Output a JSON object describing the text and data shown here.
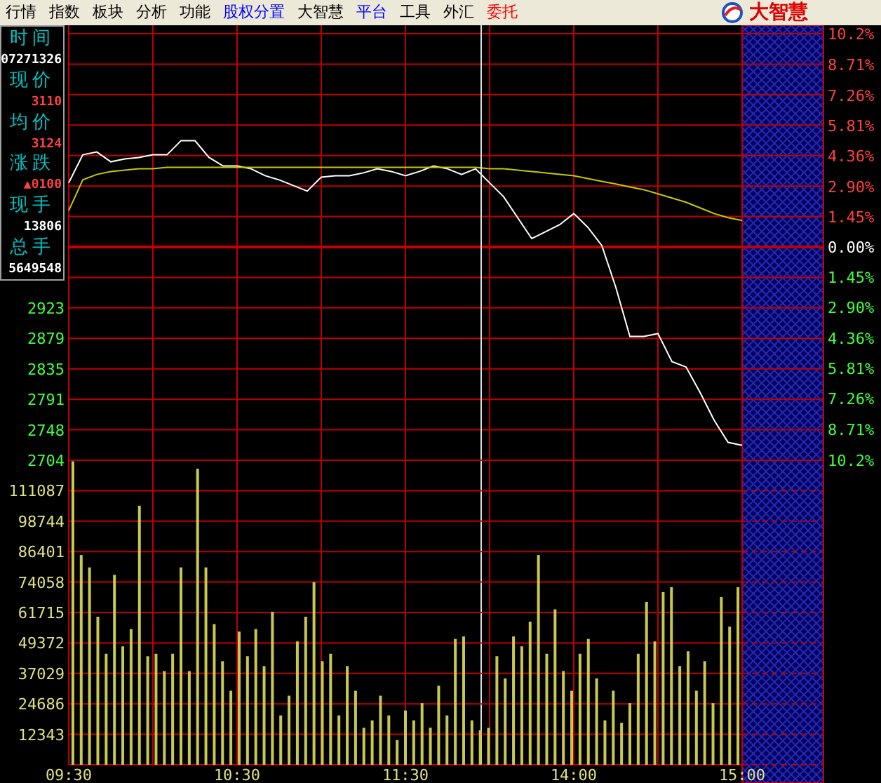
{
  "menu": [
    {
      "label": "行情",
      "color": "#000000"
    },
    {
      "label": "指数",
      "color": "#000000"
    },
    {
      "label": "板块",
      "color": "#000000"
    },
    {
      "label": "分析",
      "color": "#000000"
    },
    {
      "label": "功能",
      "color": "#000000"
    },
    {
      "label": "股权分置",
      "color": "#0000ff"
    },
    {
      "label": "大智慧",
      "color": "#000000"
    },
    {
      "label": "平台",
      "color": "#0000ff"
    },
    {
      "label": "工具",
      "color": "#000000"
    },
    {
      "label": "外汇",
      "color": "#000000"
    },
    {
      "label": "委托",
      "color": "#ff0000"
    }
  ],
  "brand": {
    "name": "大智慧"
  },
  "quote_panel": [
    {
      "label": "时间",
      "value": "07271326",
      "kind": "neutral"
    },
    {
      "label": "现价",
      "value": "3110",
      "kind": "up"
    },
    {
      "label": "均价",
      "value": "3124",
      "kind": "up"
    },
    {
      "label": "涨跌",
      "value": "▲0100",
      "kind": "up"
    },
    {
      "label": "现手",
      "value": "13806",
      "kind": "neutral"
    },
    {
      "label": "总手",
      "value": "5649548",
      "kind": "neutral"
    }
  ],
  "price_chart": {
    "left_axis_labels": [
      "2923",
      "2879",
      "2835",
      "2791",
      "2748",
      "2704"
    ],
    "chart_data": {
      "type": "line",
      "ylim": [
        -10.2,
        10.2
      ],
      "grid": true,
      "yticks": [
        {
          "value": 10.2,
          "label": "10.2%"
        },
        {
          "value": 8.71,
          "label": "8.71%"
        },
        {
          "value": 7.26,
          "label": "7.26%"
        },
        {
          "value": 5.81,
          "label": "5.81%"
        },
        {
          "value": 4.36,
          "label": "4.36%"
        },
        {
          "value": 2.9,
          "label": "2.90%"
        },
        {
          "value": 1.45,
          "label": "1.45%"
        },
        {
          "value": 0,
          "label": "0.00%"
        },
        {
          "value": -1.45,
          "label": "1.45%"
        },
        {
          "value": -2.9,
          "label": "2.90%"
        },
        {
          "value": -4.36,
          "label": "4.36%"
        },
        {
          "value": -5.81,
          "label": "5.81%"
        },
        {
          "value": -7.26,
          "label": "7.26%"
        },
        {
          "value": -8.71,
          "label": "8.71%"
        },
        {
          "value": -10.2,
          "label": "10.2%"
        }
      ],
      "series": [
        {
          "color": "#ffffff",
          "values": [
            3.07,
            4.41,
            4.54,
            4.07,
            4.21,
            4.28,
            4.41,
            4.41,
            5.08,
            5.08,
            4.28,
            3.87,
            3.87,
            3.74,
            3.41,
            3.21,
            2.94,
            2.67,
            3.34,
            3.41,
            3.41,
            3.54,
            3.74,
            3.61,
            3.41,
            3.61,
            3.87,
            3.74,
            3.47,
            3.74,
            3.07,
            2.4,
            1.4,
            0.4,
            0.73,
            1.07,
            1.6,
            0.94,
            0.07,
            -1.94,
            -4.28,
            -4.28,
            -4.14,
            -5.48,
            -5.74,
            -6.95,
            -8.28,
            -9.35,
            -9.49
          ]
        },
        {
          "color": "#c8c800",
          "values": [
            1.74,
            3.21,
            3.47,
            3.61,
            3.67,
            3.74,
            3.74,
            3.81,
            3.81,
            3.81,
            3.81,
            3.81,
            3.81,
            3.81,
            3.81,
            3.81,
            3.81,
            3.81,
            3.81,
            3.81,
            3.81,
            3.81,
            3.81,
            3.81,
            3.81,
            3.81,
            3.81,
            3.81,
            3.81,
            3.81,
            3.74,
            3.74,
            3.67,
            3.61,
            3.54,
            3.47,
            3.41,
            3.27,
            3.14,
            3.01,
            2.87,
            2.74,
            2.54,
            2.34,
            2.14,
            1.87,
            1.6,
            1.4,
            1.27
          ]
        }
      ]
    }
  },
  "volume_chart": {
    "time_labels": [
      "09:30",
      "10:30",
      "11:30",
      "14:00",
      "15:00"
    ],
    "chart_data": {
      "type": "bar",
      "ylim": [
        0,
        123430
      ],
      "grid": true,
      "yticks": [
        12343,
        24686,
        37029,
        49372,
        61715,
        74058,
        86401,
        98744,
        111087
      ],
      "values": [
        123000,
        85000,
        80000,
        60000,
        45000,
        77000,
        48000,
        55000,
        105000,
        44000,
        45000,
        38000,
        45000,
        80000,
        38000,
        120000,
        80000,
        57000,
        42000,
        30000,
        54000,
        44000,
        55000,
        40000,
        62000,
        20000,
        28000,
        50000,
        60000,
        74000,
        42000,
        45000,
        20000,
        40000,
        30000,
        15000,
        18000,
        28000,
        20000,
        10000,
        22000,
        18000,
        25000,
        15000,
        32000,
        20000,
        51000,
        52000,
        18000,
        14000,
        15000,
        44000,
        35000,
        52000,
        48000,
        58000,
        85000,
        45000,
        63000,
        38000,
        30000,
        45000,
        51000,
        35000,
        18000,
        30000,
        17000,
        25000,
        45000,
        66000,
        50000,
        70000,
        72000,
        40000,
        46000,
        30000,
        42000,
        25000,
        68000,
        56000,
        72000
      ]
    }
  }
}
